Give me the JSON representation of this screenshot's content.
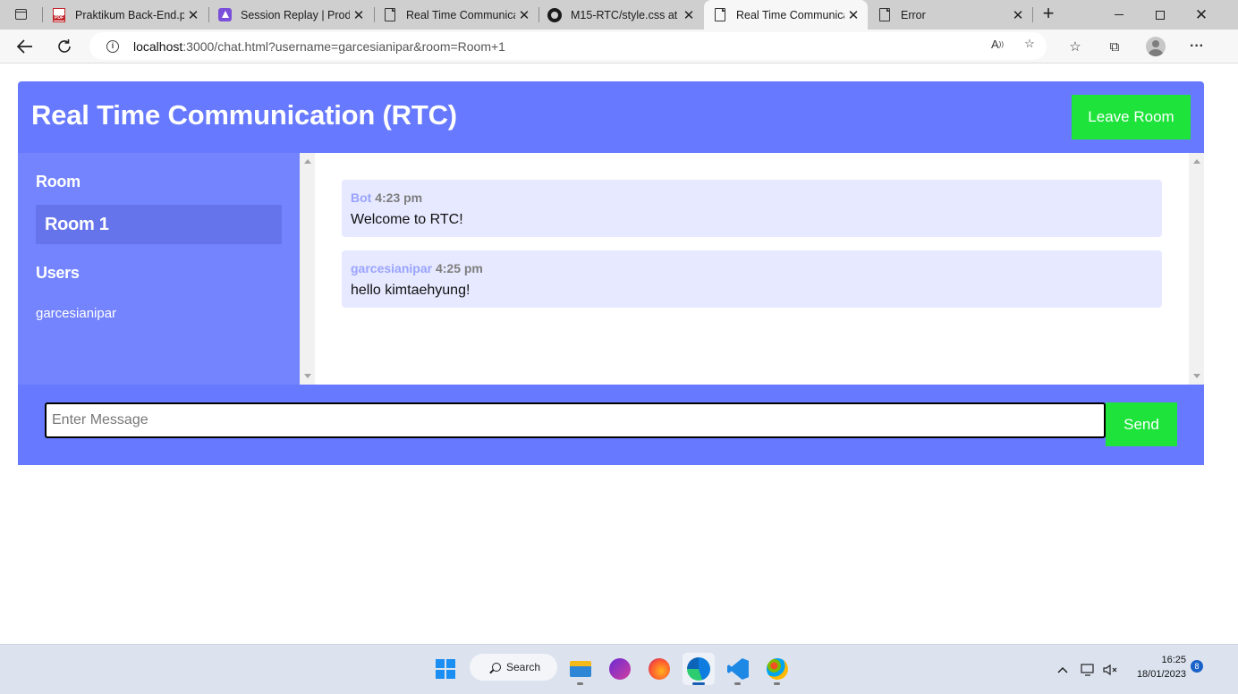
{
  "browser": {
    "tabs": [
      {
        "title": "Praktikum Back-End.pdf",
        "icon": "pdf-icon",
        "active": false
      },
      {
        "title": "Session Replay | Produ",
        "icon": "session-replay-icon",
        "active": false
      },
      {
        "title": "Real Time Communica",
        "icon": "page-icon",
        "active": false
      },
      {
        "title": "M15-RTC/style.css at m",
        "icon": "github-icon",
        "active": false
      },
      {
        "title": "Real Time Communica",
        "icon": "page-icon",
        "active": true
      },
      {
        "title": "Error",
        "icon": "page-icon",
        "active": false
      }
    ],
    "address": {
      "host": "localhost",
      "rest": ":3000/chat.html?username=garcesianipar&room=Room+1"
    }
  },
  "app": {
    "title": "Real Time Communication (RTC)",
    "leave_label": "Leave Room",
    "room_heading": "Room",
    "room_name": "Room 1",
    "users_heading": "Users",
    "users": [
      "garcesianipar"
    ],
    "messages": [
      {
        "user": "Bot",
        "time": "4:23 pm",
        "text": "Welcome to RTC!"
      },
      {
        "user": "garcesianipar",
        "time": "4:25 pm",
        "text": "hello kimtaehyung!"
      }
    ],
    "input_placeholder": "Enter Message",
    "send_label": "Send"
  },
  "taskbar": {
    "search_label": "Search",
    "time": "16:25",
    "date": "18/01/2023",
    "notification_count": "8"
  },
  "colors": {
    "header": "#6779fe",
    "sidebar": "#7484ff",
    "button": "#1de33a",
    "message_bg": "#e6e9ff"
  }
}
